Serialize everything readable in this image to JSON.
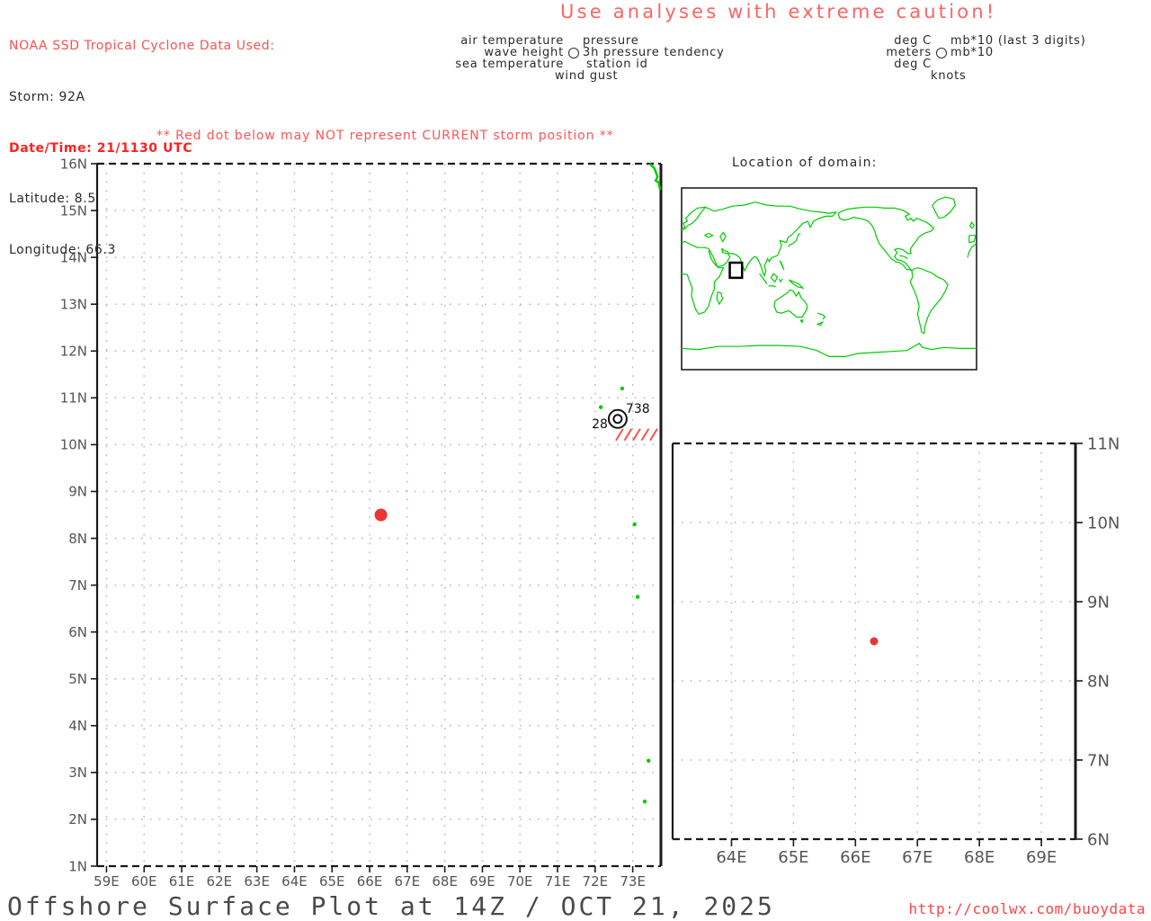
{
  "colors": {
    "red_text": "#ff5050",
    "red_bold": "#ff2020",
    "caution": "#ff6363",
    "storm_dot": "#ee3333",
    "coast_green": "#00cc00",
    "grid": "#bdbdbd",
    "axis": "#1a1a1a",
    "tick_label": "#555555",
    "hatch_red": "#ff5050"
  },
  "header": {
    "source_line": "NOAA SSD Tropical Cyclone Data Used:",
    "storm_line": "Storm: 92A",
    "datetime_line": "Date/Time: 21/1130 UTC",
    "latitude_line": "Latitude: 8.5",
    "longitude_line": "Longitude: 66.3",
    "caution": "Use analyses with extreme caution!"
  },
  "station_legend": {
    "left": [
      "air temperature",
      "wave height",
      "sea temperature"
    ],
    "right": [
      "pressure",
      "3h pressure tendency",
      "station id"
    ],
    "bottom": "wind gust"
  },
  "unit_legend": {
    "left": [
      "deg C",
      "meters",
      "deg C"
    ],
    "right": [
      "mb*10 (last 3 digits)",
      "mb*10"
    ],
    "bottom": "knots"
  },
  "warning": "** Red dot below may NOT represent CURRENT storm position **",
  "location_map": {
    "title": "Location of domain:",
    "domain_box": {
      "lon_min": 58.8,
      "lon_max": 73.8,
      "lat_min": 1,
      "lat_max": 16
    }
  },
  "chart_data": [
    {
      "type": "scatter",
      "name": "main-map",
      "xlim": [
        58.75,
        73.75
      ],
      "ylim": [
        1,
        16
      ],
      "x_ticks": [
        "59E",
        "60E",
        "61E",
        "62E",
        "63E",
        "64E",
        "65E",
        "66E",
        "67E",
        "68E",
        "69E",
        "70E",
        "71E",
        "72E",
        "73E"
      ],
      "y_ticks": [
        "1N",
        "2N",
        "3N",
        "4N",
        "5N",
        "6N",
        "7N",
        "8N",
        "9N",
        "10N",
        "11N",
        "12N",
        "13N",
        "14N",
        "15N",
        "16N"
      ],
      "grid": true,
      "points": [
        {
          "lon": 66.3,
          "lat": 8.5,
          "name": "storm-position-dot"
        }
      ],
      "station": {
        "lon": 72.6,
        "lat": 10.55,
        "value_upper_right": "738",
        "value_left": "28",
        "missing_hatch": true
      },
      "coast_polyline": [
        [
          73.45,
          16
        ],
        [
          73.58,
          15.9
        ],
        [
          73.66,
          15.72
        ],
        [
          73.61,
          15.64
        ],
        [
          73.69,
          15.6
        ],
        [
          73.73,
          15.44
        ]
      ],
      "islands": [
        [
          72.72,
          11.2
        ],
        [
          72.15,
          10.8
        ],
        [
          73.05,
          8.3
        ],
        [
          73.13,
          6.75
        ],
        [
          73.42,
          3.25
        ],
        [
          73.32,
          2.38
        ]
      ]
    },
    {
      "type": "scatter",
      "name": "zoom-map",
      "xlim": [
        63.05,
        69.55
      ],
      "ylim": [
        6,
        11
      ],
      "x_ticks": [
        "64E",
        "65E",
        "66E",
        "67E",
        "68E",
        "69E"
      ],
      "y_ticks": [
        "6N",
        "7N",
        "8N",
        "9N",
        "10N",
        "11N"
      ],
      "grid": true,
      "points": [
        {
          "lon": 66.3,
          "lat": 8.5,
          "name": "storm-position-dot"
        }
      ]
    },
    {
      "type": "map",
      "name": "location-map",
      "title": "Location of domain:",
      "domain_box": {
        "lon_min": 58.8,
        "lon_max": 73.8,
        "lat_min": 1,
        "lat_max": 16
      }
    }
  ],
  "footer": {
    "title": "Offshore Surface Plot at 14Z / OCT 21, 2025",
    "url": "http://coolwx.com/buoydata"
  }
}
